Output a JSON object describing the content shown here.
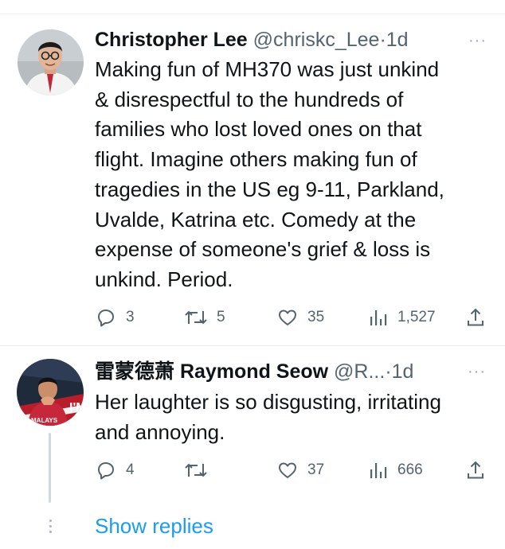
{
  "tweets": [
    {
      "name": "Christopher Lee",
      "handle": "@chriskc_Lee",
      "separator": "·",
      "time": "1d",
      "more": "···",
      "text_lines": [
        "Making fun of MH370 was just unkind",
        "& disrespectful to the hundreds of",
        "families who lost loved ones on that",
        "flight. Imagine others making fun of",
        "tragedies in the US eg 9-11, Parkland,",
        "Uvalde, Katrina etc. Comedy at the",
        "expense of someone's grief & loss is",
        "unkind. Period."
      ],
      "replies": "3",
      "retweets": "5",
      "likes": "35",
      "views": "1,527",
      "avatar_icon": "profile-photo-man-glasses"
    },
    {
      "name": "雷蒙德萧 Raymond Seow",
      "handle": "@R...",
      "separator": "·",
      "time": "1d",
      "more": "···",
      "text_lines": [
        "Her laughter is so disgusting, irritating",
        "and annoying."
      ],
      "replies": "4",
      "retweets": "",
      "likes": "37",
      "views": "666",
      "avatar_icon": "profile-photo-malaysia",
      "avatar_text": "I'M",
      "avatar_text_small": "MALAYS"
    }
  ],
  "show_replies": "Show replies",
  "colors": {
    "text": "#0f1419",
    "secondary": "#536471",
    "link": "#1d9bf0",
    "border": "#e6ecf0"
  }
}
